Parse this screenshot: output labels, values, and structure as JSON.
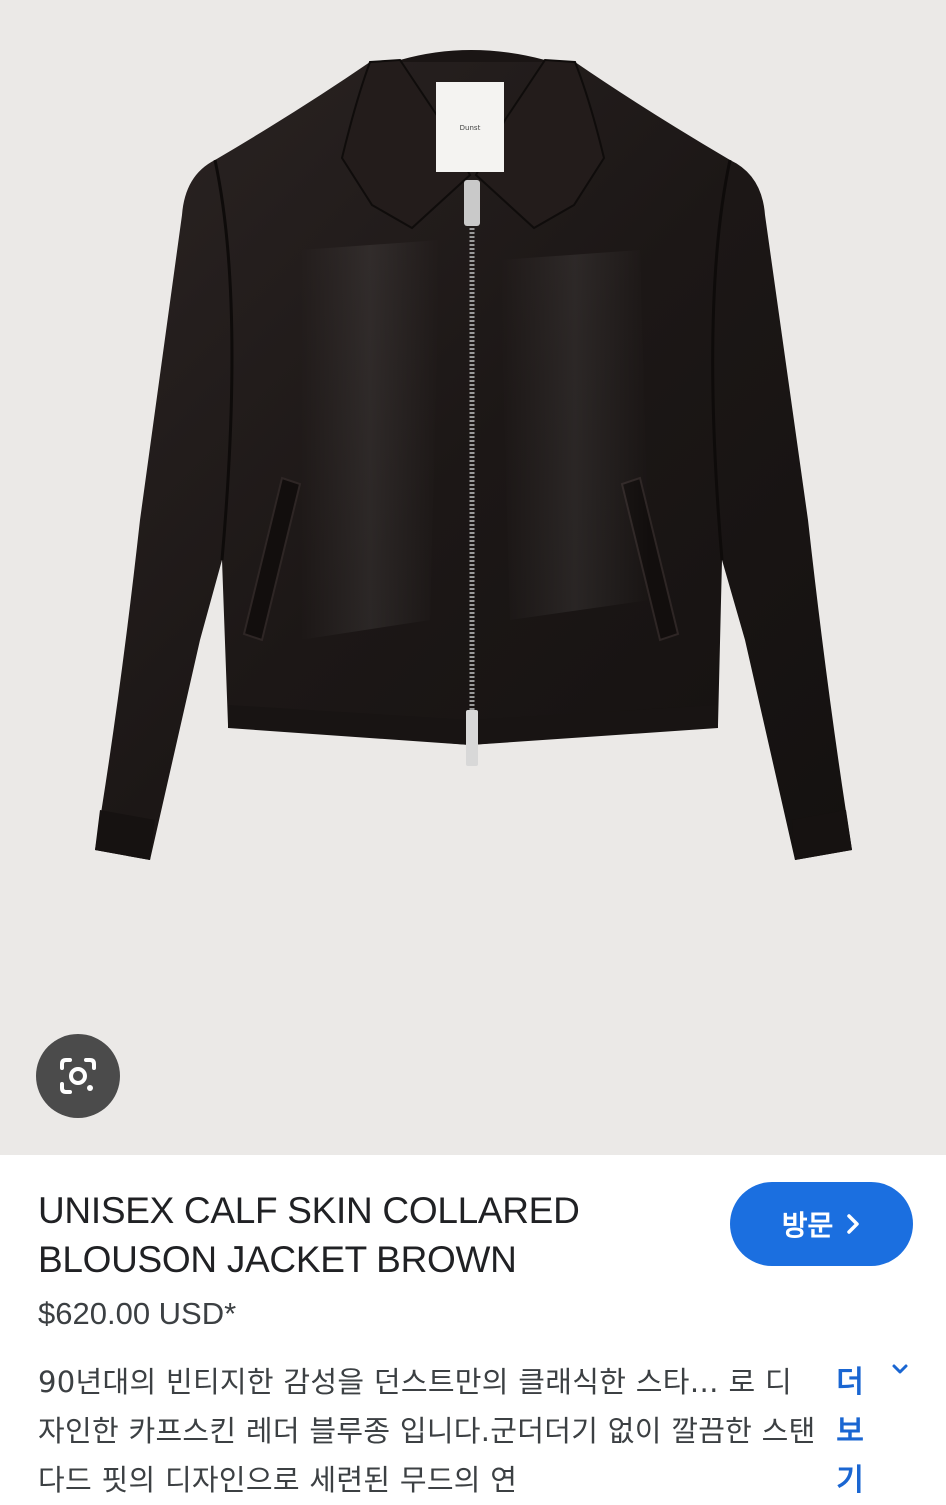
{
  "product": {
    "title": "UNISEX CALF SKIN COLLARED BLOUSON JACKET BROWN",
    "price": "$620.00 USD*",
    "description": "90년대의 빈티지한 감성을 던스트만의 클래식한 스타… 로 디자인한 카프스킨 레더 블루종 입니다.군더더기 없이 깔끔한 스탠다드 핏의 디자인으로 세련된 무드의 연",
    "label_brand": "Dunst"
  },
  "actions": {
    "visit_label": "방문",
    "more_label": "더보기"
  },
  "icons": {
    "lens": "google-lens-icon",
    "visit_chevron": "chevron-right-icon",
    "more_chevron": "chevron-down-icon"
  },
  "colors": {
    "image_background": "#ebe9e7",
    "jacket": "#1f1a19",
    "visit_button": "#1b6fe0",
    "link": "#1a66d2",
    "lens_button": "#4b4b4b"
  }
}
